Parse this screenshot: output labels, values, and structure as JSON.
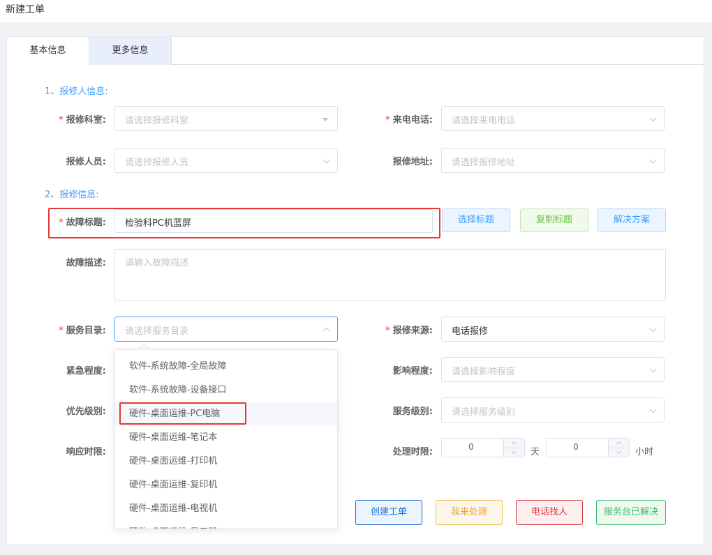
{
  "page": {
    "title": "新建工单"
  },
  "tabs": [
    {
      "label": "基本信息"
    },
    {
      "label": "更多信息"
    }
  ],
  "sections": {
    "reporter": "1、报修人信息:",
    "repair": "2、报修信息:"
  },
  "reporter": {
    "dept": {
      "label": "报修科室:",
      "placeholder": "请选择报修科室"
    },
    "phone": {
      "label": "来电电话:",
      "placeholder": "请选择来电电话"
    },
    "person": {
      "label": "报修人员:",
      "placeholder": "请选择报修人员"
    },
    "address": {
      "label": "报修地址:",
      "placeholder": "请选择报修地址"
    }
  },
  "repair": {
    "title": {
      "label": "故障标题:",
      "value": "检验科PC机蓝屏"
    },
    "title_buttons": {
      "select": "选择标题",
      "copy": "复制标题",
      "solution": "解决方案"
    },
    "desc": {
      "label": "故障描述:",
      "placeholder": "请输入故障描述"
    },
    "catalog": {
      "label": "服务目录:",
      "placeholder": "请选择服务目录"
    },
    "source": {
      "label": "报修来源:",
      "value": "电话报修"
    },
    "urgency": {
      "label": "紧急程度:"
    },
    "impact": {
      "label": "影响程度:",
      "placeholder": "请选择影响程度"
    },
    "priority": {
      "label": "优先级别:"
    },
    "service_level": {
      "label": "服务级别:",
      "placeholder": "请选择服务级别"
    },
    "response": {
      "label": "响应时限:"
    },
    "process": {
      "label": "处理时限:",
      "days": "0",
      "days_unit": "天",
      "hours": "0",
      "hours_unit": "小时"
    }
  },
  "dropdown": {
    "items": [
      "软件-系统故障-全局故障",
      "软件-系统故障-设备接口",
      "硬件-桌面运维-PC电脑",
      "硬件-桌面运维-笔记本",
      "硬件-桌面运维-打印机",
      "硬件-桌面运维-复印机",
      "硬件-桌面运维-电视机",
      "硬件-桌面运维-显示器"
    ],
    "highlighted": "硬件-桌面运维-PC电脑"
  },
  "actions": {
    "create": "创建工单",
    "handle": "我来处理",
    "call": "电话找人",
    "resolved": "服务台已解决"
  },
  "colors": {
    "primary": "#409eff",
    "required": "#f56c6c",
    "highlight_box": "#e53935"
  }
}
